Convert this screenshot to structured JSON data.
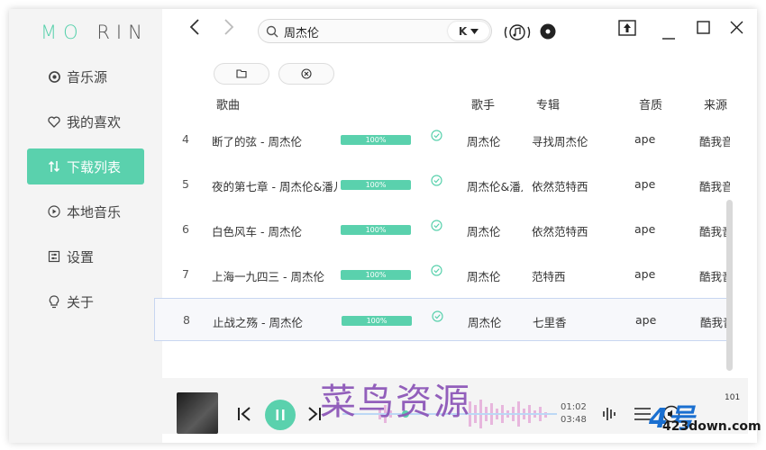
{
  "app": {
    "logo_accent": "MO",
    "logo_rest": "RIN"
  },
  "sidebar": {
    "items": [
      {
        "label": "音乐源",
        "icon": "disc-icon"
      },
      {
        "label": "我的喜欢",
        "icon": "heart-icon"
      },
      {
        "label": "下载列表",
        "icon": "sort-arrows-icon",
        "active": true
      },
      {
        "label": "本地音乐",
        "icon": "play-circle-icon"
      },
      {
        "label": "设置",
        "icon": "settings-icon"
      },
      {
        "label": "关于",
        "icon": "bulb-icon"
      }
    ]
  },
  "search": {
    "value": "周杰伦",
    "source_badge": "K"
  },
  "table": {
    "headers": {
      "song": "歌曲",
      "artist": "歌手",
      "album": "专辑",
      "quality": "音质",
      "source": "来源"
    },
    "rows": [
      {
        "idx": "4",
        "title": "断了的弦 - 周杰伦",
        "progress": "100%",
        "artist": "周杰伦",
        "album": "寻找周杰伦",
        "quality": "ape",
        "source": "酷我音乐"
      },
      {
        "idx": "5",
        "title": "夜的第七章 - 周杰伦&潘儿",
        "progress": "100%",
        "artist": "周杰伦&潘儿",
        "album": "依然范特西",
        "quality": "ape",
        "source": "酷我音乐"
      },
      {
        "idx": "6",
        "title": "白色风车 - 周杰伦",
        "progress": "100%",
        "artist": "周杰伦",
        "album": "依然范特西",
        "quality": "ape",
        "source": "酷我音乐"
      },
      {
        "idx": "7",
        "title": "上海一九四三 - 周杰伦",
        "progress": "100%",
        "artist": "周杰伦",
        "album": "范特西",
        "quality": "ape",
        "source": "酷我音乐"
      },
      {
        "idx": "8",
        "title": "止战之殇 - 周杰伦",
        "progress": "100%",
        "artist": "周杰伦",
        "album": "七里香",
        "quality": "ape",
        "source": "酷我音乐"
      }
    ]
  },
  "player": {
    "current_time": "01:02",
    "total_time": "03:48",
    "volume": "101"
  },
  "watermark": {
    "text": "菜鸟资源",
    "site_big": "4号",
    "site_small": "423down.com"
  },
  "colors": {
    "accent": "#5ad1ad"
  }
}
